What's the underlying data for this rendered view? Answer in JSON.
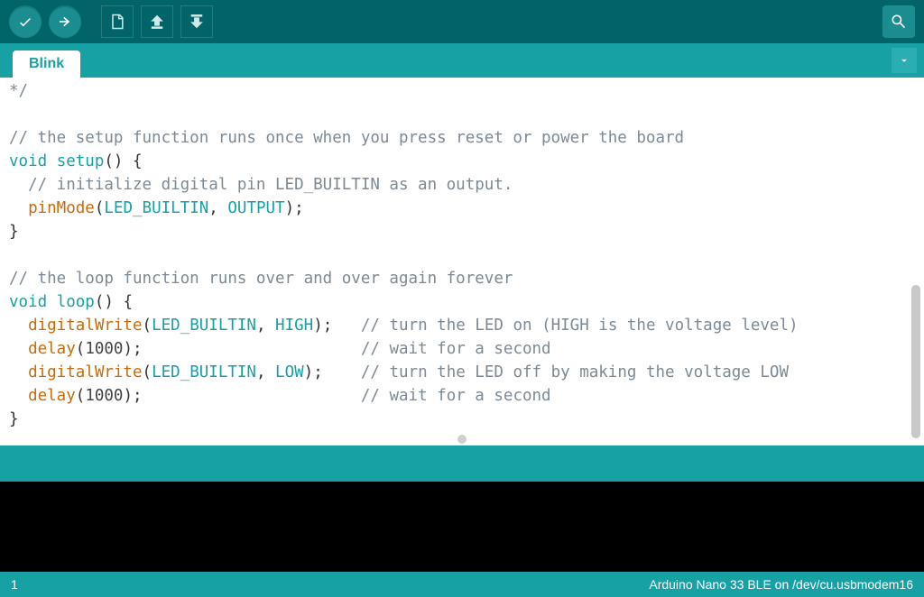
{
  "toolbar": {
    "verify_tooltip": "Verify",
    "upload_tooltip": "Upload",
    "new_tooltip": "New",
    "open_tooltip": "Open",
    "save_tooltip": "Save",
    "serial_tooltip": "Serial Monitor"
  },
  "tabs": [
    {
      "label": "Blink"
    }
  ],
  "code": {
    "lines": [
      {
        "t": "frag",
        "text": "*/"
      },
      {
        "t": "blank"
      },
      {
        "t": "comment",
        "text": "// the setup function runs once when you press reset or power the board"
      },
      {
        "t": "sig",
        "kw": "void",
        "fn": "setup",
        "rest": "() {"
      },
      {
        "t": "comment_indent",
        "text": "  // initialize digital pin LED_BUILTIN as an output."
      },
      {
        "t": "call1",
        "indent": "  ",
        "fn": "pinMode",
        "a1": "LED_BUILTIN",
        "a2": "OUTPUT",
        "tail": ");"
      },
      {
        "t": "plain",
        "text": "}"
      },
      {
        "t": "blank"
      },
      {
        "t": "comment",
        "text": "// the loop function runs over and over again forever"
      },
      {
        "t": "sig",
        "kw": "void",
        "fn": "loop",
        "rest": "() {"
      },
      {
        "t": "call1",
        "indent": "  ",
        "fn": "digitalWrite",
        "a1": "LED_BUILTIN",
        "a2": "HIGH",
        "tail": ");   ",
        "cmt": "// turn the LED on (HIGH is the voltage level)"
      },
      {
        "t": "call2",
        "indent": "  ",
        "fn": "delay",
        "a1": "1000",
        "tail": ");                       ",
        "cmt": "// wait for a second"
      },
      {
        "t": "call1",
        "indent": "  ",
        "fn": "digitalWrite",
        "a1": "LED_BUILTIN",
        "a2": "LOW",
        "tail": ");    ",
        "cmt": "// turn the LED off by making the voltage LOW"
      },
      {
        "t": "call2",
        "indent": "  ",
        "fn": "delay",
        "a1": "1000",
        "tail": ");                       ",
        "cmt": "// wait for a second"
      },
      {
        "t": "plain",
        "text": "}"
      }
    ]
  },
  "status": {
    "left": "1",
    "right": "Arduino Nano 33 BLE on /dev/cu.usbmodem16"
  },
  "colors": {
    "accent": "#17a1a5",
    "toolbar": "#006468",
    "console": "#000000"
  }
}
